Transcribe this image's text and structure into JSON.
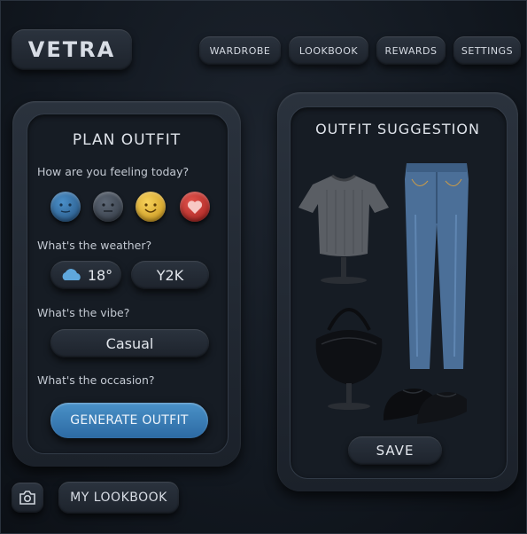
{
  "brand": {
    "logo": "VETRA"
  },
  "nav": [
    {
      "label": "WARDROBE"
    },
    {
      "label": "LOOKBOOK"
    },
    {
      "label": "REWARDS"
    },
    {
      "label": "SETTINGS"
    }
  ],
  "plan": {
    "title": "PLAN OUTFIT",
    "feeling_q": "How are you feeling today?",
    "moods": [
      {
        "icon": "calm-face-icon",
        "color": "#2f6aa0"
      },
      {
        "icon": "neutral-face-icon",
        "color": "#4b5563"
      },
      {
        "icon": "happy-face-icon",
        "color": "#e3b634"
      },
      {
        "icon": "heart-icon",
        "color": "#c9302c"
      }
    ],
    "weather_q": "What's the weather?",
    "weather": {
      "icon": "cloud-icon",
      "temp": "18°"
    },
    "style_tag": "Y2K",
    "vibe_q": "What's the vibe?",
    "vibe": "Casual",
    "occasion_q": "What's the occasion?",
    "generate_label": "GENERATE OUTFIT"
  },
  "suggestion": {
    "title": "OUTFIT SUGGESTION",
    "items": [
      {
        "icon": "tshirt-icon"
      },
      {
        "icon": "jeans-icon"
      },
      {
        "icon": "handbag-icon"
      },
      {
        "icon": "shoes-icon"
      }
    ],
    "save_label": "SAVE"
  },
  "footer": {
    "camera_icon": "camera-icon",
    "lookbook_label": "MY LOOKBOOK"
  }
}
